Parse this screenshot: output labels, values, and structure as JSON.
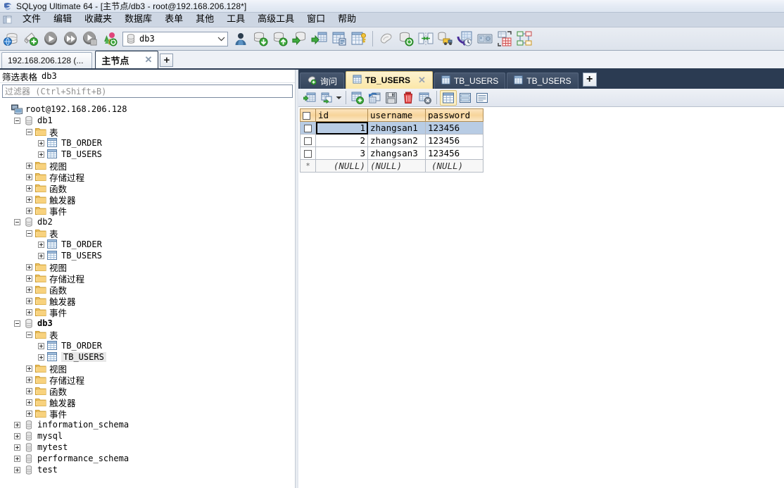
{
  "window": {
    "app_icon": "sqlyog-logo-icon",
    "title": "SQLyog Ultimate 64 - [主节点/db3 - root@192.168.206.128*]"
  },
  "menu": {
    "items": [
      {
        "label": "文件"
      },
      {
        "label": "编辑"
      },
      {
        "label": "收藏夹"
      },
      {
        "label": "数据库"
      },
      {
        "label": "表单"
      },
      {
        "label": "其他"
      },
      {
        "label": "工具"
      },
      {
        "label": "高级工具"
      },
      {
        "label": "窗口"
      },
      {
        "label": "帮助"
      }
    ]
  },
  "toolbar": {
    "db_selector_value": "db3",
    "buttons": [
      {
        "name": "new-connection-icon"
      },
      {
        "name": "new-connection-add-icon"
      },
      {
        "name": "execute-query-icon"
      },
      {
        "name": "execute-all-queries-icon"
      },
      {
        "name": "execute-query-stop-icon"
      },
      {
        "name": "refresh-objects-icon"
      }
    ],
    "buttons_right": [
      {
        "name": "user-manager-icon"
      },
      {
        "name": "backup-database-icon"
      },
      {
        "name": "restore-database-icon"
      },
      {
        "name": "import-external-data-icon"
      },
      {
        "name": "export-table-data-icon"
      },
      {
        "name": "export-as-sql-icon"
      },
      {
        "name": "schema-designer-icon"
      },
      {
        "name": "sql-formatter-icon"
      },
      {
        "name": "database-sync-icon"
      },
      {
        "name": "schema-sync-icon"
      },
      {
        "name": "migration-toolkit-icon"
      },
      {
        "name": "scheduled-backup-icon"
      },
      {
        "name": "notifications-icon"
      },
      {
        "name": "query-builder-icon"
      },
      {
        "name": "schema-designer-2-icon"
      }
    ]
  },
  "connection_tabs": {
    "tabs": [
      {
        "label": "192.168.206.128 (...",
        "active": false,
        "closable": false
      },
      {
        "label": "主节点",
        "active": true,
        "closable": true
      }
    ],
    "add_label": "+"
  },
  "left_panel": {
    "filter_label_cn": "筛选表格",
    "filter_label_db": "db3",
    "filter_placeholder_cn": "过滤器",
    "filter_placeholder_key": "(Ctrl+Shift+B)",
    "tree": [
      {
        "indent": 0,
        "toggle": "none",
        "icon": "server-icon",
        "label": "root@192.168.206.128",
        "mono": true,
        "bold": false
      },
      {
        "indent": 1,
        "toggle": "minus",
        "icon": "database-icon",
        "label": "db1",
        "mono": true,
        "bold": false
      },
      {
        "indent": 2,
        "toggle": "minus",
        "icon": "folder-icon",
        "label": "表",
        "mono": false,
        "bold": false
      },
      {
        "indent": 3,
        "toggle": "plus",
        "icon": "table-icon",
        "label": "TB_ORDER",
        "mono": true,
        "bold": false
      },
      {
        "indent": 3,
        "toggle": "plus",
        "icon": "table-icon",
        "label": "TB_USERS",
        "mono": true,
        "bold": false
      },
      {
        "indent": 2,
        "toggle": "plus",
        "icon": "folder-icon",
        "label": "视图",
        "mono": false,
        "bold": false
      },
      {
        "indent": 2,
        "toggle": "plus",
        "icon": "folder-icon",
        "label": "存储过程",
        "mono": false,
        "bold": false
      },
      {
        "indent": 2,
        "toggle": "plus",
        "icon": "folder-icon",
        "label": "函数",
        "mono": false,
        "bold": false
      },
      {
        "indent": 2,
        "toggle": "plus",
        "icon": "folder-icon",
        "label": "触发器",
        "mono": false,
        "bold": false
      },
      {
        "indent": 2,
        "toggle": "plus",
        "icon": "folder-icon",
        "label": "事件",
        "mono": false,
        "bold": false
      },
      {
        "indent": 1,
        "toggle": "minus",
        "icon": "database-icon",
        "label": "db2",
        "mono": true,
        "bold": false
      },
      {
        "indent": 2,
        "toggle": "minus",
        "icon": "folder-icon",
        "label": "表",
        "mono": false,
        "bold": false
      },
      {
        "indent": 3,
        "toggle": "plus",
        "icon": "table-icon",
        "label": "TB_ORDER",
        "mono": true,
        "bold": false
      },
      {
        "indent": 3,
        "toggle": "plus",
        "icon": "table-icon",
        "label": "TB_USERS",
        "mono": true,
        "bold": false
      },
      {
        "indent": 2,
        "toggle": "plus",
        "icon": "folder-icon",
        "label": "视图",
        "mono": false,
        "bold": false
      },
      {
        "indent": 2,
        "toggle": "plus",
        "icon": "folder-icon",
        "label": "存储过程",
        "mono": false,
        "bold": false
      },
      {
        "indent": 2,
        "toggle": "plus",
        "icon": "folder-icon",
        "label": "函数",
        "mono": false,
        "bold": false
      },
      {
        "indent": 2,
        "toggle": "plus",
        "icon": "folder-icon",
        "label": "触发器",
        "mono": false,
        "bold": false
      },
      {
        "indent": 2,
        "toggle": "plus",
        "icon": "folder-icon",
        "label": "事件",
        "mono": false,
        "bold": false
      },
      {
        "indent": 1,
        "toggle": "minus",
        "icon": "database-icon",
        "label": "db3",
        "mono": true,
        "bold": true
      },
      {
        "indent": 2,
        "toggle": "minus",
        "icon": "folder-icon",
        "label": "表",
        "mono": false,
        "bold": false
      },
      {
        "indent": 3,
        "toggle": "plus",
        "icon": "table-icon",
        "label": "TB_ORDER",
        "mono": true,
        "bold": false
      },
      {
        "indent": 3,
        "toggle": "plus",
        "icon": "table-icon",
        "label": "TB_USERS",
        "mono": true,
        "bold": false,
        "selected": true
      },
      {
        "indent": 2,
        "toggle": "plus",
        "icon": "folder-icon",
        "label": "视图",
        "mono": false,
        "bold": false
      },
      {
        "indent": 2,
        "toggle": "plus",
        "icon": "folder-icon",
        "label": "存储过程",
        "mono": false,
        "bold": false
      },
      {
        "indent": 2,
        "toggle": "plus",
        "icon": "folder-icon",
        "label": "函数",
        "mono": false,
        "bold": false
      },
      {
        "indent": 2,
        "toggle": "plus",
        "icon": "folder-icon",
        "label": "触发器",
        "mono": false,
        "bold": false
      },
      {
        "indent": 2,
        "toggle": "plus",
        "icon": "folder-icon",
        "label": "事件",
        "mono": false,
        "bold": false
      },
      {
        "indent": 1,
        "toggle": "plus",
        "icon": "database-gray-icon",
        "label": "information_schema",
        "mono": true,
        "bold": false
      },
      {
        "indent": 1,
        "toggle": "plus",
        "icon": "database-gray-icon",
        "label": "mysql",
        "mono": true,
        "bold": false
      },
      {
        "indent": 1,
        "toggle": "plus",
        "icon": "database-gray-icon",
        "label": "mytest",
        "mono": true,
        "bold": false
      },
      {
        "indent": 1,
        "toggle": "plus",
        "icon": "database-gray-icon",
        "label": "performance_schema",
        "mono": true,
        "bold": false
      },
      {
        "indent": 1,
        "toggle": "plus",
        "icon": "database-gray-icon",
        "label": "test",
        "mono": true,
        "bold": false
      }
    ]
  },
  "right_panel": {
    "object_tabs": [
      {
        "label": "询问",
        "icon": "query-icon",
        "active": false,
        "closable": false
      },
      {
        "label": "TB_USERS",
        "icon": "table-icon",
        "active": true,
        "closable": true
      },
      {
        "label": "TB_USERS",
        "icon": "table-icon",
        "active": false,
        "closable": false
      },
      {
        "label": "TB_USERS",
        "icon": "table-icon",
        "active": false,
        "closable": false
      }
    ],
    "add_label": "+",
    "grid_toolbar": [
      {
        "name": "refresh-data-icon",
        "pressed": false
      },
      {
        "name": "refresh-data-options-icon",
        "pressed": false
      },
      {
        "name": "insert-row-icon",
        "pressed": false
      },
      {
        "name": "undo-changes-icon",
        "pressed": false
      },
      {
        "name": "save-changes-icon",
        "pressed": false
      },
      {
        "name": "delete-row-icon",
        "pressed": false
      },
      {
        "name": "cancel-edit-icon",
        "pressed": false
      },
      {
        "name": "grid-view-icon",
        "pressed": true
      },
      {
        "name": "form-view-icon",
        "pressed": false
      },
      {
        "name": "text-view-icon",
        "pressed": false
      }
    ],
    "grid": {
      "columns": [
        "id",
        "username",
        "password"
      ],
      "rows": [
        {
          "id": "1",
          "username": "zhangsan1",
          "password": "123456",
          "selected": true
        },
        {
          "id": "2",
          "username": "zhangsan2",
          "password": "123456",
          "selected": false
        },
        {
          "id": "3",
          "username": "zhangsan3",
          "password": "123456",
          "selected": false
        }
      ],
      "new_row": {
        "marker": "*",
        "id": "(NULL)",
        "username": "(NULL)",
        "password": "(NULL)"
      }
    }
  },
  "colors": {
    "titlebar_bg": "#e6ecf5",
    "menubar_bg": "#cdd6e3",
    "toolbar_bg": "#e4e9f1",
    "tabstrip_dark": "#2b3b52",
    "active_tab_bg": "#fbe7a8",
    "grid_header_bg": "#f7d49a",
    "row_selected_bg": "#b8cce4",
    "tree_selected_bg": "#e8e8e8"
  }
}
